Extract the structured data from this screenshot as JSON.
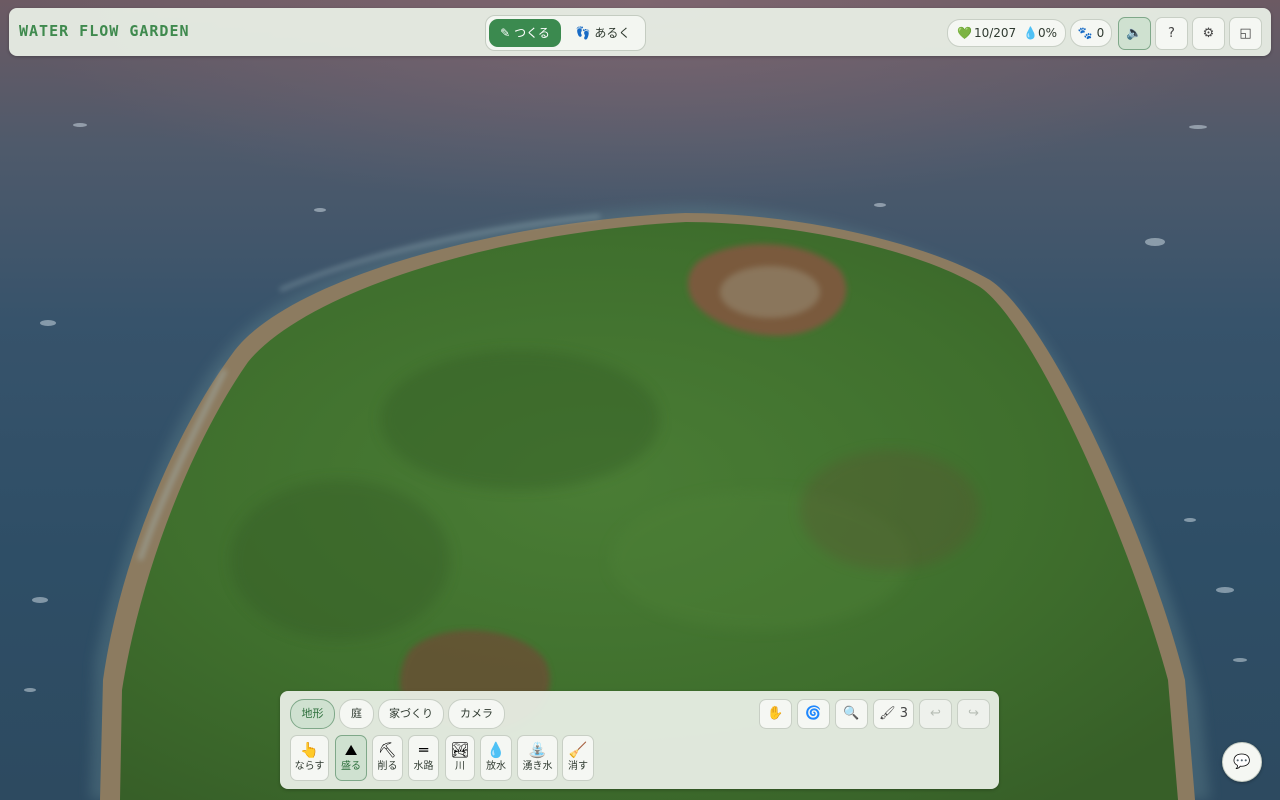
{
  "app": {
    "title": "WATER FLOW GARDEN"
  },
  "modes": [
    {
      "label": "つくる",
      "icon": "pencil-icon",
      "active": true
    },
    {
      "label": "あるく",
      "icon": "footprints-icon",
      "active": false
    }
  ],
  "stats": {
    "heart_icon": "💚",
    "plants": "10/207",
    "water_icon": "💧",
    "water": "0%"
  },
  "paws": {
    "icon": "🐾",
    "count": "0"
  },
  "header_buttons": {
    "sound": "🔈",
    "help": "?",
    "settings": "⚙",
    "window": "◱"
  },
  "categories": [
    {
      "label": "地形",
      "active": true
    },
    {
      "label": "庭",
      "active": false
    },
    {
      "label": "家づくり",
      "active": false
    },
    {
      "label": "カメラ",
      "active": false
    }
  ],
  "tools": [
    {
      "label": "ならす",
      "icon": "👆",
      "active": false
    },
    {
      "label": "盛る",
      "icon": "⛰",
      "active": true
    },
    {
      "label": "削る",
      "icon": "⛏",
      "active": false
    },
    {
      "label": "水路",
      "icon": "═",
      "active": false
    },
    {
      "label": "川",
      "icon": "🏞",
      "active": false
    },
    {
      "label": "放水",
      "icon": "💧",
      "active": false
    },
    {
      "label": "湧き水",
      "icon": "⛲",
      "active": false
    },
    {
      "label": "消す",
      "icon": "🧹",
      "active": false
    }
  ],
  "controls": {
    "hand": "✋",
    "swirl": "🌀",
    "zoom": "🔍",
    "brush_icon": "🖌",
    "brush_size": "3",
    "undo": "↩",
    "redo": "↪"
  },
  "chat": {
    "icon": "💬"
  },
  "colors": {
    "accent": "#3b8a4f",
    "panel": "#e8eee5",
    "grass": "#3f6f2e",
    "sand": "#8c7a5f",
    "sea": "#2e4e66"
  }
}
